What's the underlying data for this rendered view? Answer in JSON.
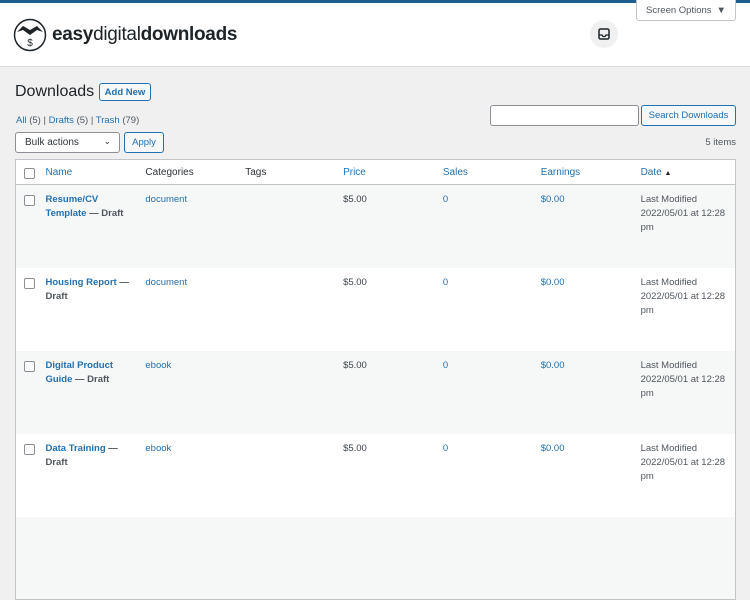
{
  "header": {
    "logo_bold": "easy",
    "logo_light": "digital",
    "logo_bold2": "downloads",
    "screen_options": "Screen Options"
  },
  "page": {
    "title": "Downloads",
    "add_new": "Add New"
  },
  "filters": {
    "all": "All",
    "all_count": "(5)",
    "drafts": "Drafts",
    "drafts_count": "(5)",
    "trash": "Trash",
    "trash_count": "(79)"
  },
  "bulk": {
    "selected": "Bulk actions",
    "apply": "Apply"
  },
  "search": {
    "value": "",
    "button": "Search Downloads"
  },
  "items_count": "5 items",
  "columns": {
    "name": "Name",
    "categories": "Categories",
    "tags": "Tags",
    "price": "Price",
    "sales": "Sales",
    "earnings": "Earnings",
    "date": "Date",
    "sort_indicator": "▲"
  },
  "rows": [
    {
      "title": "Resume/CV Template",
      "status": "— Draft",
      "category": "document",
      "tags": "",
      "price": "$5.00",
      "sales": "0",
      "earnings": "$0.00",
      "date_label": "Last Modified",
      "date": "2022/05/01 at 12:28 pm"
    },
    {
      "title": "Housing Report",
      "status": "— Draft",
      "category": "document",
      "tags": "",
      "price": "$5.00",
      "sales": "0",
      "earnings": "$0.00",
      "date_label": "Last Modified",
      "date": "2022/05/01 at 12:28 pm"
    },
    {
      "title": "Digital Product Guide",
      "status": "— Draft",
      "category": "ebook",
      "tags": "",
      "price": "$5.00",
      "sales": "0",
      "earnings": "$0.00",
      "date_label": "Last Modified",
      "date": "2022/05/01 at 12:28 pm"
    },
    {
      "title": "Data Training",
      "status": "— Draft",
      "category": "ebook",
      "tags": "",
      "price": "$5.00",
      "sales": "0",
      "earnings": "$0.00",
      "date_label": "Last Modified",
      "date": "2022/05/01 at 12:28 pm"
    }
  ]
}
